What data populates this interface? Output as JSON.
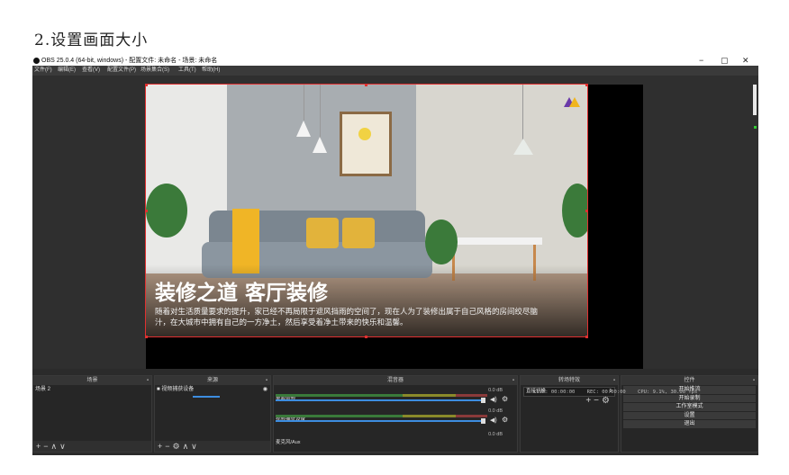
{
  "heading": "2.设置画面大小",
  "window": {
    "title": "OBS 25.0.4 (64-bit, windows) - 配置文件: 未命名 - 场景: 未命名",
    "controls": {
      "minimize": "−",
      "maximize": "▢",
      "close": "✕"
    }
  },
  "menu": [
    "文件(F)",
    "编辑(E)",
    "查看(V)",
    "配置文件(P)",
    "场景集合(S)",
    "工具(T)",
    "帮助(H)"
  ],
  "preview": {
    "title": "装修之道 客厅装修",
    "caption_line1": "随着对生活质量要求的提升，家已经不再局限于遮风挡雨的空间了，现在人为了装修出属于自己风格的房间绞尽脑",
    "caption_line2": "汁，在大城市中拥有自己的一方净土，然后享受着净土带来的快乐和温馨。"
  },
  "docks": {
    "scenes": {
      "header": "场景",
      "items": [
        "场景 2"
      ]
    },
    "sources": {
      "header": "来源",
      "items": [
        "视频捕获设备"
      ]
    },
    "mixer": {
      "header": "混音器",
      "channels": [
        {
          "name": "桌面音频",
          "db": "0.0 dB"
        },
        {
          "name": "视频捕获设备",
          "db": "0.0 dB"
        },
        {
          "name": "麦克风/Aux",
          "db": "0.0 dB"
        }
      ]
    },
    "transitions": {
      "header": "转场特效",
      "selected": "直接切换"
    },
    "controls": {
      "header": "控件",
      "buttons": [
        "开始推流",
        "开始录制",
        "工作室模式",
        "设置",
        "退出"
      ]
    }
  },
  "status": {
    "live": "LIVE: 00:00:00",
    "rec": "REC: 00:00:00",
    "cpu": "CPU: 9.1%, 30.00 fps"
  }
}
